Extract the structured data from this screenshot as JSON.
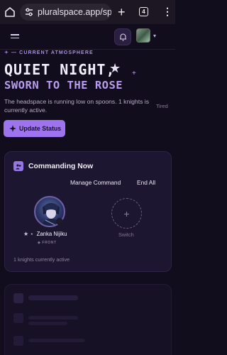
{
  "browser": {
    "url": "pluralspace.app/sp",
    "tab_count": "4"
  },
  "hero": {
    "eyebrow": "— CURRENT ATMOSPHERE",
    "title_line1": "QUIET NIGHT,",
    "title_line2": "SWORN TO THE ROSE",
    "description": "The headspace is running low on spoons. 1 knights is currently active.",
    "mood": "Tired",
    "update_button": "Update Status"
  },
  "commanding": {
    "title": "Commanding Now",
    "manage_link": "Manage Command",
    "end_all_link": "End All",
    "member_name": "Zanka Nijiku",
    "member_prefix": "★ ⋆",
    "front_label": "◆ FRONT",
    "switch_label": "Switch",
    "active_count": "1 knights currently active"
  },
  "colors": {
    "accent": "#9e74ee",
    "background": "#120d1c",
    "card": "#1d1630"
  }
}
